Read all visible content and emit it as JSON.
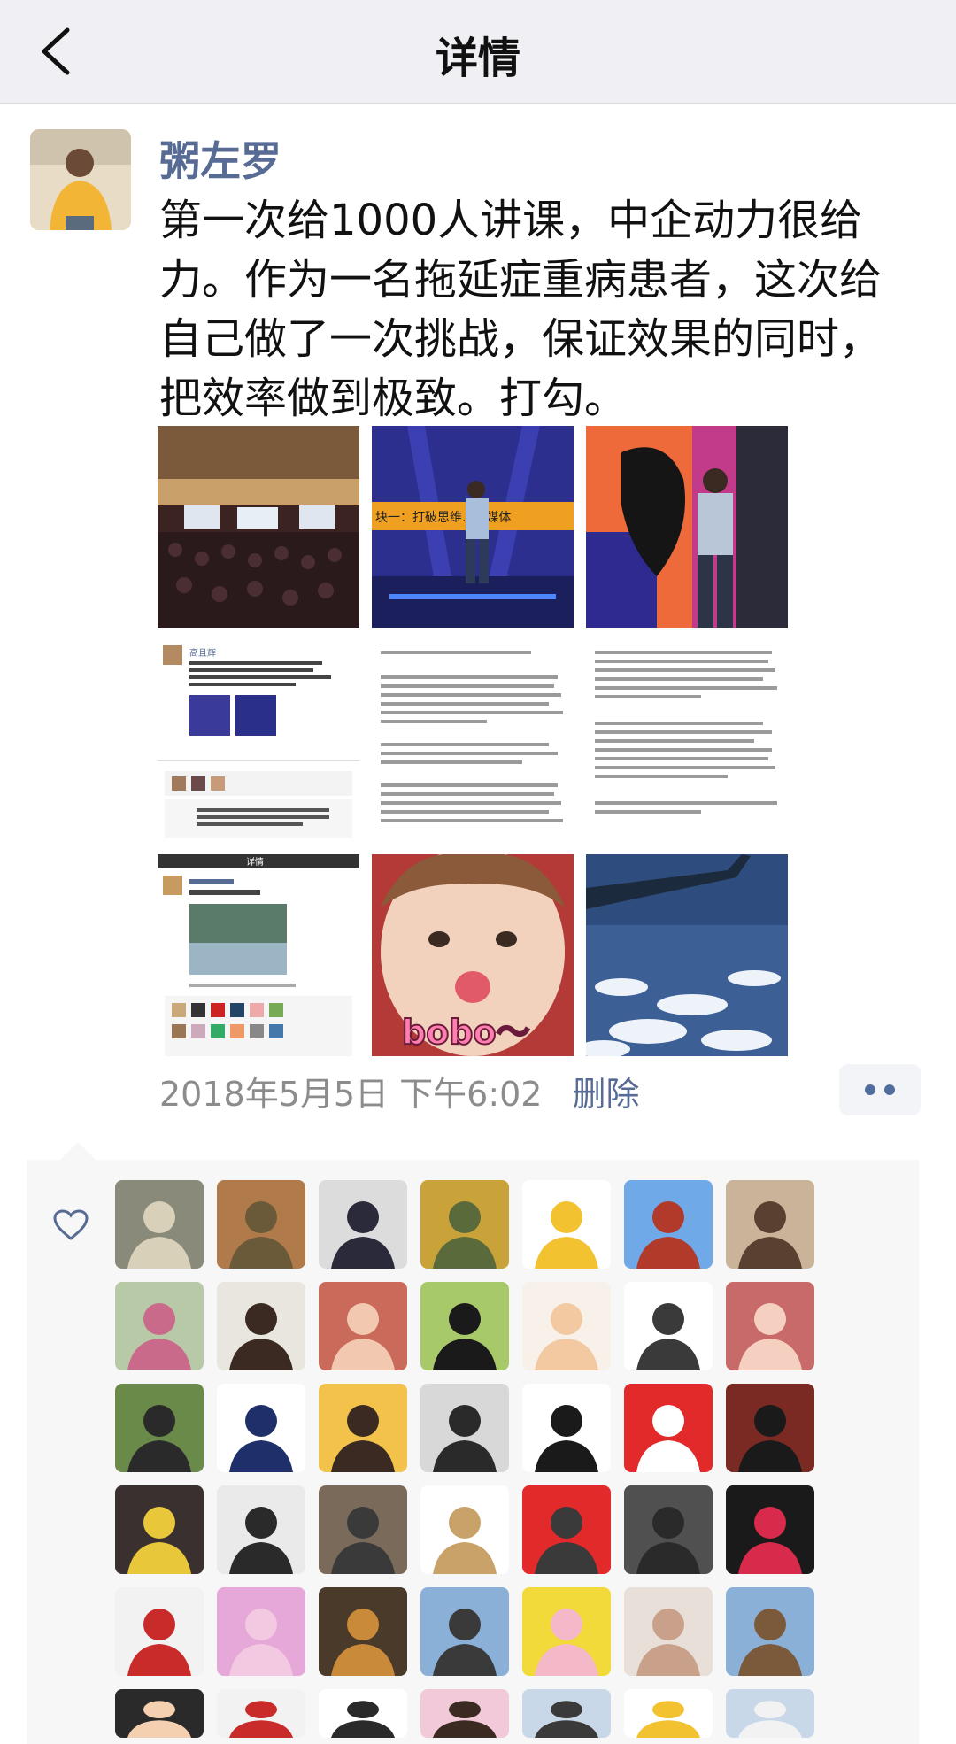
{
  "nav": {
    "title": "详情",
    "back_icon": "chevron-left-icon"
  },
  "post": {
    "author": "粥左罗",
    "text": "第一次给1000人讲课，中企动力很给力。作为一名拖延症重病患者，这次给自己做了一次挑战，保证效果的同时，把效率做到极致。打勾。",
    "images": [
      {
        "name": "conference-hall-photo"
      },
      {
        "name": "speaker-on-stage-photo",
        "caption": "块一：打破思维...新媒体"
      },
      {
        "name": "speaker-with-screen-photo"
      },
      {
        "name": "moments-screenshot-photo",
        "caption": "高且辉"
      },
      {
        "name": "article-text-screenshot-1"
      },
      {
        "name": "article-text-screenshot-2"
      },
      {
        "name": "moments-detail-screenshot",
        "caption": "详情"
      },
      {
        "name": "baby-kiss-photo",
        "caption": "bobo～"
      },
      {
        "name": "airplane-wing-photo"
      }
    ],
    "timestamp": "2018年5月5日 下午6:02",
    "delete_label": "删除",
    "more_icon": "more-dots-icon"
  },
  "likes": {
    "heart_icon": "heart-outline-icon",
    "colors": {
      "link": "#576b95",
      "accent_more": "#4f6e9e"
    }
  }
}
